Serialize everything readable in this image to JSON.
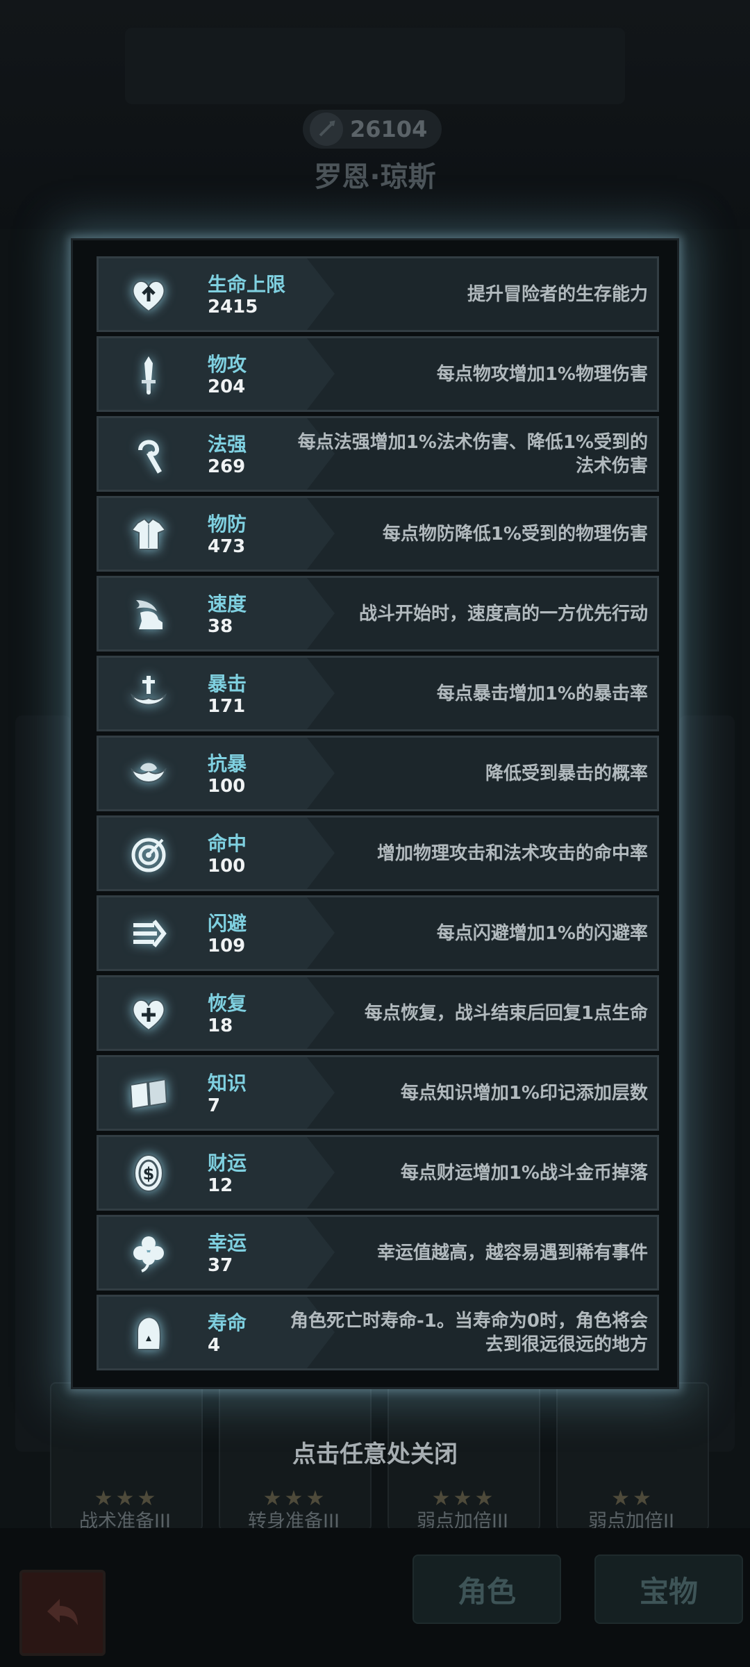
{
  "header": {
    "power_value": "26104",
    "hero_name": "罗恩·琼斯"
  },
  "stats": [
    {
      "icon": "heart-arrow-icon",
      "name": "生命上限",
      "value": "2415",
      "desc": "提升冒险者的生存能力"
    },
    {
      "icon": "sword-icon",
      "name": "物攻",
      "value": "204",
      "desc": "每点物攻增加1%物理伤害"
    },
    {
      "icon": "staff-icon",
      "name": "法强",
      "value": "269",
      "desc": "每点法强增加1%法术伤害、降低1%受到的法术伤害"
    },
    {
      "icon": "armor-icon",
      "name": "物防",
      "value": "473",
      "desc": "每点物防降低1%受到的物理伤害"
    },
    {
      "icon": "winged-boot-icon",
      "name": "速度",
      "value": "38",
      "desc": "战斗开始时，速度高的一方优先行动"
    },
    {
      "icon": "crit-icon",
      "name": "暴击",
      "value": "171",
      "desc": "每点暴击增加1%的暴击率"
    },
    {
      "icon": "crit-resist-icon",
      "name": "抗暴",
      "value": "100",
      "desc": "降低受到暴击的概率"
    },
    {
      "icon": "target-icon",
      "name": "命中",
      "value": "100",
      "desc": "增加物理攻击和法术攻击的命中率"
    },
    {
      "icon": "dodge-icon",
      "name": "闪避",
      "value": "109",
      "desc": "每点闪避增加1%的闪避率"
    },
    {
      "icon": "heart-plus-icon",
      "name": "恢复",
      "value": "18",
      "desc": "每点恢复，战斗结束后回复1点生命"
    },
    {
      "icon": "book-icon",
      "name": "知识",
      "value": "7",
      "desc": "每点知识增加1%印记添加层数"
    },
    {
      "icon": "coin-icon",
      "name": "财运",
      "value": "12",
      "desc": "每点财运增加1%战斗金币掉落"
    },
    {
      "icon": "clover-icon",
      "name": "幸运",
      "value": "37",
      "desc": "幸运值越高，越容易遇到稀有事件"
    },
    {
      "icon": "tombstone-icon",
      "name": "寿命",
      "value": "4",
      "desc": "角色死亡时寿命-1。当寿命为0时，角色将会去到很远很远的地方"
    }
  ],
  "close_hint": "点击任意处关闭",
  "skill_cards": [
    {
      "name": "战术准备III",
      "stars": "★★★"
    },
    {
      "name": "转身准备III",
      "stars": "★★★"
    },
    {
      "name": "弱点加倍III",
      "stars": "★★★"
    },
    {
      "name": "弱点加倍II",
      "stars": "★★"
    }
  ],
  "bottom_tabs": {
    "role": "角色",
    "treasure": "宝物"
  },
  "colors": {
    "stat_name": "#7fd0e0",
    "stat_value": "#f0f3f4",
    "glow": "#78b4c8"
  }
}
